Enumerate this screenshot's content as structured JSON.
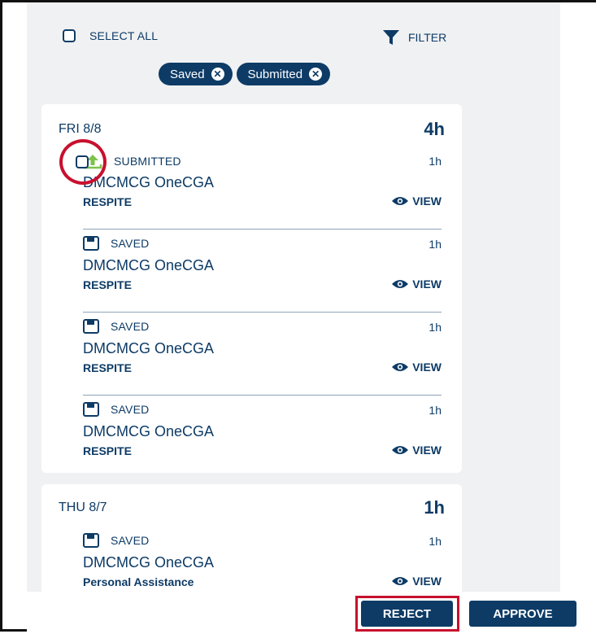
{
  "toolbar": {
    "select_all_label": "SELECT ALL",
    "filter_label": "FILTER"
  },
  "chips": [
    "Saved",
    "Submitted"
  ],
  "days": [
    {
      "label": "FRI 8/8",
      "total": "4h",
      "entries": [
        {
          "status": "SUBMITTED",
          "hours": "1h",
          "program": "DMCMCG OneCGA",
          "service": "RESPITE",
          "view": "VIEW"
        },
        {
          "status": "SAVED",
          "hours": "1h",
          "program": "DMCMCG OneCGA",
          "service": "RESPITE",
          "view": "VIEW"
        },
        {
          "status": "SAVED",
          "hours": "1h",
          "program": "DMCMCG OneCGA",
          "service": "RESPITE",
          "view": "VIEW"
        },
        {
          "status": "SAVED",
          "hours": "1h",
          "program": "DMCMCG OneCGA",
          "service": "RESPITE",
          "view": "VIEW"
        }
      ]
    },
    {
      "label": "THU 8/7",
      "total": "1h",
      "entries": [
        {
          "status": "SAVED",
          "hours": "1h",
          "program": "DMCMCG OneCGA",
          "service": "Personal Assistance",
          "view": "VIEW"
        }
      ]
    }
  ],
  "footer": {
    "reject_label": "REJECT",
    "approve_label": "APPROVE"
  },
  "colors": {
    "primary": "#0d3b66",
    "submitted_icon": "#7dc24b",
    "highlight": "#c8102e",
    "panel_bg": "#f0f1f3"
  },
  "icons": {
    "filter": "funnel-icon",
    "chip_remove": "close-circle-icon",
    "submitted": "upload-arrow-icon",
    "saved": "floppy-disk-icon",
    "view": "eye-icon"
  }
}
